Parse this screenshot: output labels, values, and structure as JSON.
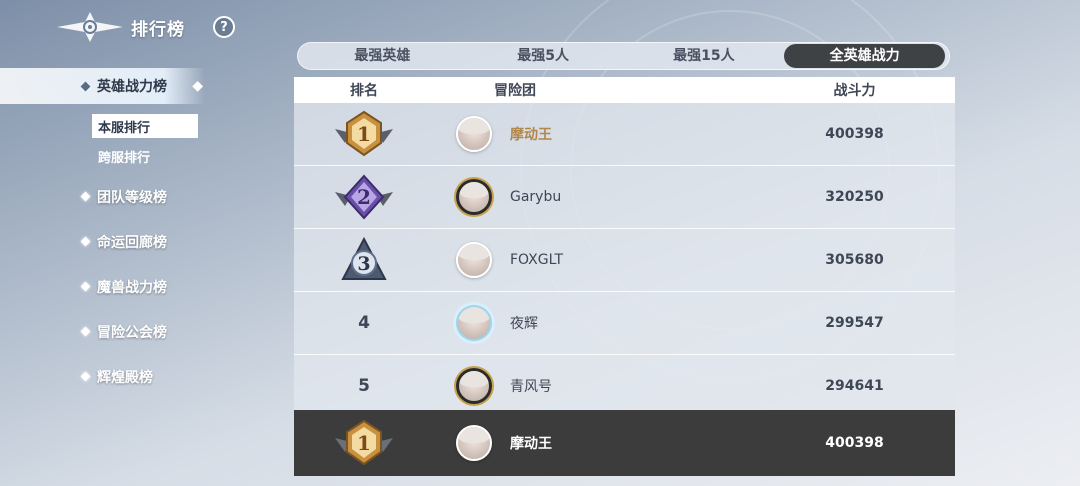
{
  "header": {
    "title": "排行榜",
    "help_label": "?"
  },
  "sidebar": {
    "active_main": "英雄战力榜",
    "sub_items": [
      {
        "label": "本服排行",
        "active": true
      },
      {
        "label": "跨服排行",
        "active": false
      }
    ],
    "items": [
      {
        "label": "团队等级榜"
      },
      {
        "label": "命运回廊榜"
      },
      {
        "label": "魔兽战力榜"
      },
      {
        "label": "冒险公会榜"
      },
      {
        "label": "辉煌殿榜"
      }
    ]
  },
  "tabs": [
    {
      "label": "最强英雄",
      "active": false
    },
    {
      "label": "最强5人",
      "active": false
    },
    {
      "label": "最强15人",
      "active": false
    },
    {
      "label": "全英雄战力",
      "active": true
    }
  ],
  "table": {
    "headers": {
      "rank": "排名",
      "team": "冒险团",
      "power": "战斗力"
    },
    "rows": [
      {
        "rank": "1",
        "badge": "gold-rank-badge-icon",
        "name": "摩动王",
        "power": "400398"
      },
      {
        "rank": "2",
        "badge": "purple-rank-badge-icon",
        "name": "Garybu",
        "power": "320250"
      },
      {
        "rank": "3",
        "badge": "silver-rank-badge-icon",
        "name": "FOXGLT",
        "power": "305680"
      },
      {
        "rank": "4",
        "name": "夜辉",
        "power": "299547"
      },
      {
        "rank": "5",
        "name": "青风号",
        "power": "294641"
      }
    ]
  },
  "self": {
    "rank": "1",
    "name": "摩动王",
    "power": "400398"
  },
  "colors": {
    "gold": "#c9913f",
    "purple": "#6a4fa8",
    "silver": "#5f6f8c",
    "active_tab": "#3f4245",
    "self_row": "#3c3c3c"
  }
}
